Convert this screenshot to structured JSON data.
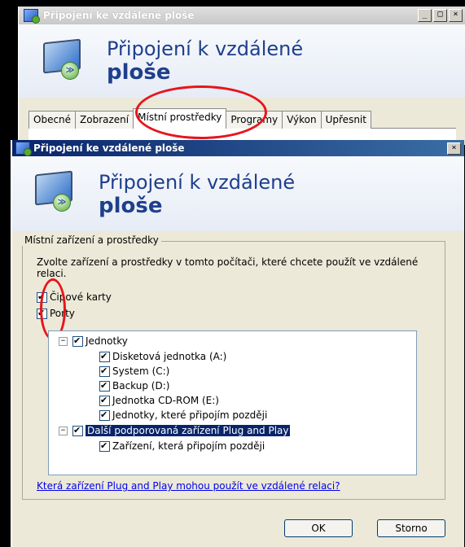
{
  "back_window": {
    "title": "Připojení ke vzdálené ploše",
    "controls": [
      "_",
      "□",
      "×"
    ],
    "banner": {
      "line1": "Připojení k vzdálené",
      "line2": "ploše"
    },
    "tabs": [
      {
        "label": "Obecné"
      },
      {
        "label": "Zobrazení"
      },
      {
        "label": "Místní prostředky",
        "active": true
      },
      {
        "label": "Programy"
      },
      {
        "label": "Výkon"
      },
      {
        "label": "Upřesnit"
      }
    ]
  },
  "dialog": {
    "title": "Připojení ke vzdálené ploše",
    "close": "×",
    "banner": {
      "line1": "Připojení k vzdálené",
      "line2": "ploše"
    },
    "group_label": "Místní zařízení a prostředky",
    "description": "Zvolte zařízení a prostředky v tomto počítači, které chcete použít ve vzdálené relaci.",
    "checkboxes": [
      {
        "label": "Čipové karty",
        "checked": true
      },
      {
        "label": "Porty",
        "checked": true
      }
    ],
    "tree": {
      "drives": {
        "label": "Jednotky",
        "toggle": "−",
        "items": [
          "Disketová jednotka (A:)",
          "System (C:)",
          "Backup (D:)",
          "Jednotka CD-ROM (E:)",
          "Jednotky, které připojím později"
        ]
      },
      "pnp": {
        "label": "Další podporovaná zařízení Plug and Play",
        "toggle": "−",
        "items": [
          "Zařízení, která připojím později"
        ]
      }
    },
    "link": "Která zařízení Plug and Play mohou použít ve vzdálené relaci?",
    "buttons": {
      "ok": "OK",
      "cancel": "Storno"
    }
  },
  "colors": {
    "highlight_ellipse": "#e8141b",
    "banner_text": "#1e3f8c",
    "selection": "#0a246a"
  }
}
